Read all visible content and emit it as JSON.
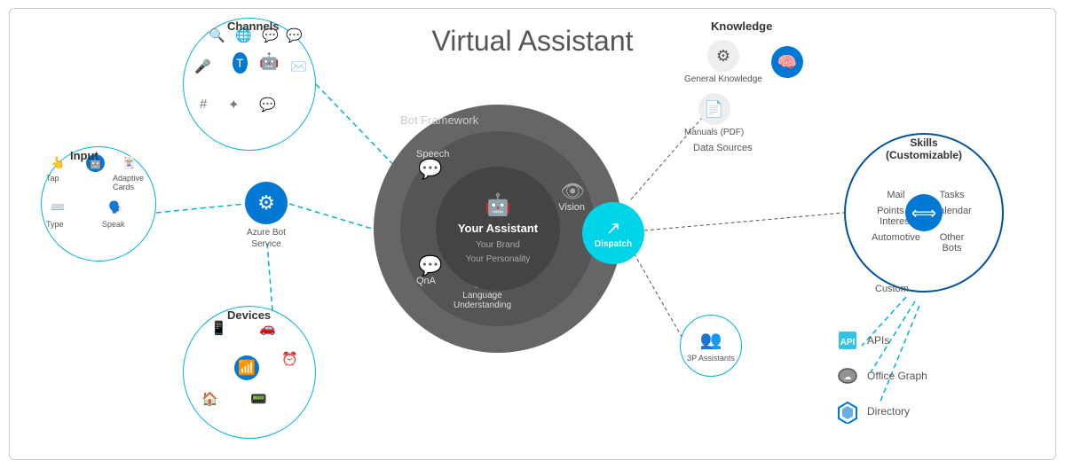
{
  "title": "Virtual Assistant",
  "channels": {
    "label": "Channels",
    "icons": [
      "search",
      "globe",
      "skype",
      "teams",
      "bot",
      "messenger",
      "mic",
      "email",
      "hashtag",
      "slack",
      "chat"
    ]
  },
  "input": {
    "label": "Input",
    "items": [
      "Tap",
      "Adaptive Cards",
      "Type",
      "Speak"
    ]
  },
  "devices": {
    "label": "Devices"
  },
  "azure_bot": {
    "label": "Azure Bot\nService"
  },
  "bot_framework": {
    "label": "Bot Framework"
  },
  "your_assistant": {
    "line1": "Your Assistant",
    "line2": "Your Brand",
    "line3": "Your Personality"
  },
  "dispatch": {
    "label": "Dispatch"
  },
  "speech": {
    "label": "Speech"
  },
  "qna": {
    "label": "QnA"
  },
  "vision": {
    "label": "Vision"
  },
  "language_understanding": {
    "label": "Language\nUnderstanding"
  },
  "knowledge": {
    "label": "Knowledge",
    "items": [
      "General Knowledge",
      "Manuals (PDF)",
      "Data Sources"
    ]
  },
  "skills": {
    "label": "Skills\n(Customizable)",
    "items": [
      "Mail",
      "Tasks",
      "Points of Interest",
      "Calendar",
      "Automotive",
      "Other Bots",
      "Custom"
    ]
  },
  "threep": {
    "label": "3P Assistants"
  },
  "bottom_items": [
    {
      "label": "APIs"
    },
    {
      "label": "Office Graph"
    },
    {
      "label": "Directory"
    }
  ]
}
